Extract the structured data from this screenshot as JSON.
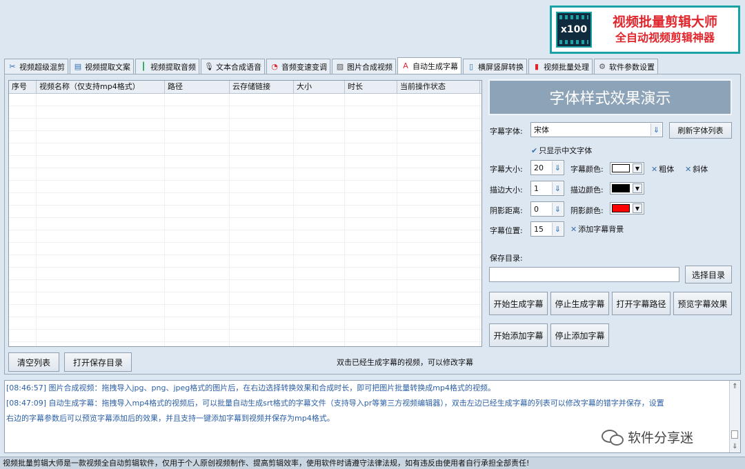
{
  "logo": {
    "badge": "x100",
    "line1": "视频批量剪辑大师",
    "line2": "全自动视频剪辑神器"
  },
  "tabs": [
    {
      "label": "视频超级混剪",
      "icon": "scissors-icon",
      "glyph": "✂",
      "color": "#2d6db3"
    },
    {
      "label": "视频提取文案",
      "icon": "document-icon",
      "glyph": "▤",
      "color": "#2d6db3"
    },
    {
      "label": "视频提取音频",
      "icon": "audio-wave-icon",
      "glyph": "┃",
      "color": "#1ea84a"
    },
    {
      "label": "文本合成语音",
      "icon": "microphone-icon",
      "glyph": "🎙",
      "color": "#333333"
    },
    {
      "label": "音频变速变调",
      "icon": "gauge-icon",
      "glyph": "◔",
      "color": "#e0262d"
    },
    {
      "label": "图片合成视频",
      "icon": "image-icon",
      "glyph": "▨",
      "color": "#555555"
    },
    {
      "label": "自动生成字幕",
      "icon": "font-icon",
      "glyph": "A",
      "color": "#e0262d"
    },
    {
      "label": "横屏竖屏转换",
      "icon": "rotate-screen-icon",
      "glyph": "▯",
      "color": "#2d6db3"
    },
    {
      "label": "视频批量处理",
      "icon": "film-icon",
      "glyph": "▮",
      "color": "#e0262d"
    },
    {
      "label": "软件参数设置",
      "icon": "gear-icon",
      "glyph": "⚙",
      "color": "#555555"
    }
  ],
  "table": {
    "columns": [
      "序号",
      "视频名称（仅支持mp4格式）",
      "路径",
      "云存储链接",
      "大小",
      "时长",
      "当前操作状态"
    ]
  },
  "buttons": {
    "clear_list": "清空列表",
    "open_save_dir": "打开保存目录",
    "refresh_fonts": "刷新字体列表",
    "choose_dir": "选择目录",
    "start_gen": "开始生成字幕",
    "stop_gen": "停止生成字幕",
    "open_sub_path": "打开字幕路径",
    "preview_sub": "预览字幕效果",
    "start_add": "开始添加字幕",
    "stop_add": "停止添加字幕"
  },
  "note": "双击已经生成字幕的视频，可以修改字幕",
  "settings": {
    "demo_text": "字体样式效果演示",
    "font_label": "字幕字体:",
    "font_value": "宋体",
    "only_chinese": "只显示中文字体",
    "size_label": "字幕大小:",
    "size_value": "20",
    "color_label": "字幕颜色:",
    "color_value": "#ffffff",
    "bold": "粗体",
    "italic": "斜体",
    "stroke_size_label": "描边大小:",
    "stroke_size_value": "1",
    "stroke_color_label": "描边颜色:",
    "stroke_color_value": "#000000",
    "shadow_label": "阴影距离:",
    "shadow_value": "0",
    "shadow_color_label": "阴影颜色:",
    "shadow_color_value": "#ff0000",
    "position_label": "字幕位置:",
    "position_value": "15",
    "add_bg": "添加字幕背景",
    "save_dir_label": "保存目录:",
    "save_dir_value": ""
  },
  "log": [
    "[08:46:57] 图片合成视频：拖拽导入jpg、png、jpeg格式的图片后，在右边选择转换效果和合成时长，即可把图片批量转换成mp4格式的视频。",
    "[08:47:09] 自动生成字幕：拖拽导入mp4格式的视频后，可以批量自动生成srt格式的字幕文件（支持导入pr等第三方视频编辑器），双击左边已经生成字幕的列表可以修改字幕的错字并保存，设置",
    "右边的字幕参数后可以预览字幕添加后的效果，并且支持一键添加字幕到视频并保存为mp4格式。"
  ],
  "watermark": "软件分享迷",
  "status_bar": "视频批量剪辑大师是一款视频全自动剪辑软件，仅用于个人原创视频制作、提高剪辑效率，使用软件时请遵守法律法规，如有违反由使用者自行承担全部责任!"
}
